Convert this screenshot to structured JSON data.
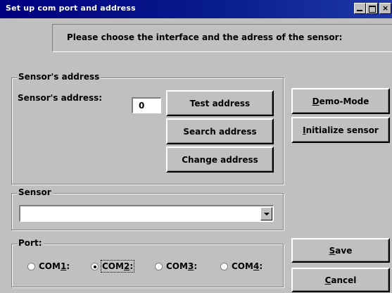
{
  "window": {
    "title": "Set up com port and address"
  },
  "instruction": "Please choose the interface and the adress of the sensor:",
  "address_group": {
    "label": "Sensor's address",
    "field_label": "Sensor's address:",
    "field_value": "0",
    "test_button": "Test address",
    "search_button": "Search address",
    "change_button": "Change address"
  },
  "side_buttons": {
    "demo_prefix": "",
    "demo_mnemonic": "D",
    "demo_rest": "emo-Mode",
    "init_mnemonic": "I",
    "init_rest": "nitialize sensor"
  },
  "sensor_group": {
    "label": "Sensor",
    "selected": ""
  },
  "port_group": {
    "label": "Port:",
    "options": [
      {
        "prefix": "COM",
        "mnemonic": "1",
        "suffix": ":",
        "selected": false
      },
      {
        "prefix": "COM",
        "mnemonic": "2",
        "suffix": ":",
        "selected": true
      },
      {
        "prefix": "COM",
        "mnemonic": "3",
        "suffix": ":",
        "selected": false
      },
      {
        "prefix": "COM",
        "mnemonic": "4",
        "suffix": ":",
        "selected": false
      }
    ]
  },
  "actions": {
    "save_mnemonic": "S",
    "save_rest": "ave",
    "cancel_mnemonic": "C",
    "cancel_rest": "ancel"
  }
}
